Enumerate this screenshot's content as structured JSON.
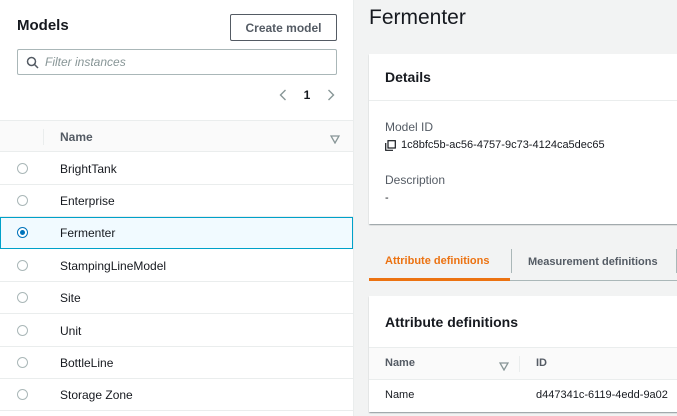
{
  "left": {
    "title": "Models",
    "create_button": "Create model",
    "filter_placeholder": "Filter instances",
    "page_number": "1",
    "column_name": "Name",
    "rows": [
      {
        "label": "BrightTank",
        "selected": false
      },
      {
        "label": "Enterprise",
        "selected": false
      },
      {
        "label": "Fermenter",
        "selected": true
      },
      {
        "label": "StampingLineModel",
        "selected": false
      },
      {
        "label": "Site",
        "selected": false
      },
      {
        "label": "Unit",
        "selected": false
      },
      {
        "label": "BottleLine",
        "selected": false
      },
      {
        "label": "Storage Zone",
        "selected": false
      }
    ]
  },
  "right": {
    "title": "Fermenter",
    "details": {
      "heading": "Details",
      "model_id_label": "Model ID",
      "model_id_value": "1c8bfc5b-ac56-4757-9c73-4124ca5dec65",
      "description_label": "Description",
      "description_value": "-"
    },
    "tabs": [
      {
        "label": "Attribute definitions",
        "active": true
      },
      {
        "label": "Measurement definitions",
        "active": false
      }
    ],
    "attributes": {
      "heading": "Attribute definitions",
      "col_name": "Name",
      "col_id": "ID",
      "rows": [
        {
          "name": "Name",
          "id": "d447341c-6119-4edd-9a02"
        }
      ]
    }
  },
  "colors": {
    "accent": "#ec7211",
    "selection_border": "#00a1c9",
    "radio": "#0073bb"
  }
}
